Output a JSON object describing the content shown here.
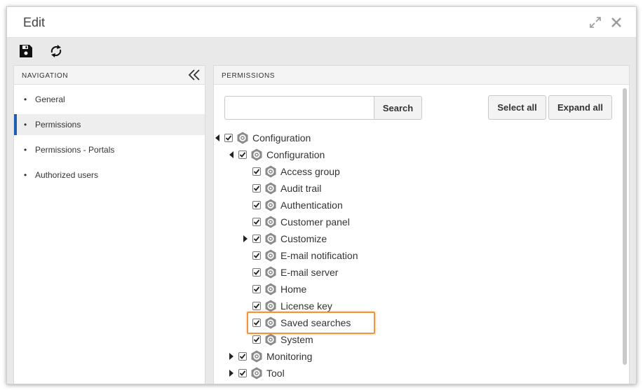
{
  "window": {
    "title": "Edit"
  },
  "toolbar": {
    "save_icon": "save-icon",
    "refresh_icon": "refresh-icon"
  },
  "navigation": {
    "header": "NAVIGATION",
    "items": [
      {
        "label": "General",
        "active": false
      },
      {
        "label": "Permissions",
        "active": true
      },
      {
        "label": "Permissions - Portals",
        "active": false
      },
      {
        "label": "Authorized users",
        "active": false
      }
    ]
  },
  "permissions": {
    "header": "PERMISSIONS",
    "search": {
      "value": "",
      "button_label": "Search"
    },
    "select_all_label": "Select all",
    "expand_all_label": "Expand all",
    "tree": [
      {
        "label": "Configuration",
        "level": 0,
        "toggle": "expanded",
        "checked": true
      },
      {
        "label": "Configuration",
        "level": 1,
        "toggle": "expanded",
        "checked": true
      },
      {
        "label": "Access group",
        "level": 2,
        "toggle": "none",
        "checked": true
      },
      {
        "label": "Audit trail",
        "level": 2,
        "toggle": "none",
        "checked": true
      },
      {
        "label": "Authentication",
        "level": 2,
        "toggle": "none",
        "checked": true
      },
      {
        "label": "Customer panel",
        "level": 2,
        "toggle": "none",
        "checked": true
      },
      {
        "label": "Customize",
        "level": 2,
        "toggle": "collapsed",
        "checked": true
      },
      {
        "label": "E-mail notification",
        "level": 2,
        "toggle": "none",
        "checked": true
      },
      {
        "label": "E-mail server",
        "level": 2,
        "toggle": "none",
        "checked": true
      },
      {
        "label": "Home",
        "level": 2,
        "toggle": "none",
        "checked": true
      },
      {
        "label": "License key",
        "level": 2,
        "toggle": "none",
        "checked": true
      },
      {
        "label": "Saved searches",
        "level": 2,
        "toggle": "none",
        "checked": true,
        "highlighted": true
      },
      {
        "label": "System",
        "level": 2,
        "toggle": "none",
        "checked": true
      },
      {
        "label": "Monitoring",
        "level": 1,
        "toggle": "collapsed",
        "checked": true
      },
      {
        "label": "Tool",
        "level": 1,
        "toggle": "collapsed",
        "checked": true
      }
    ]
  },
  "colors": {
    "active_indicator": "#1f5fae",
    "highlight_border": "#f0963c",
    "icon_gray": "#8a8a8a"
  }
}
